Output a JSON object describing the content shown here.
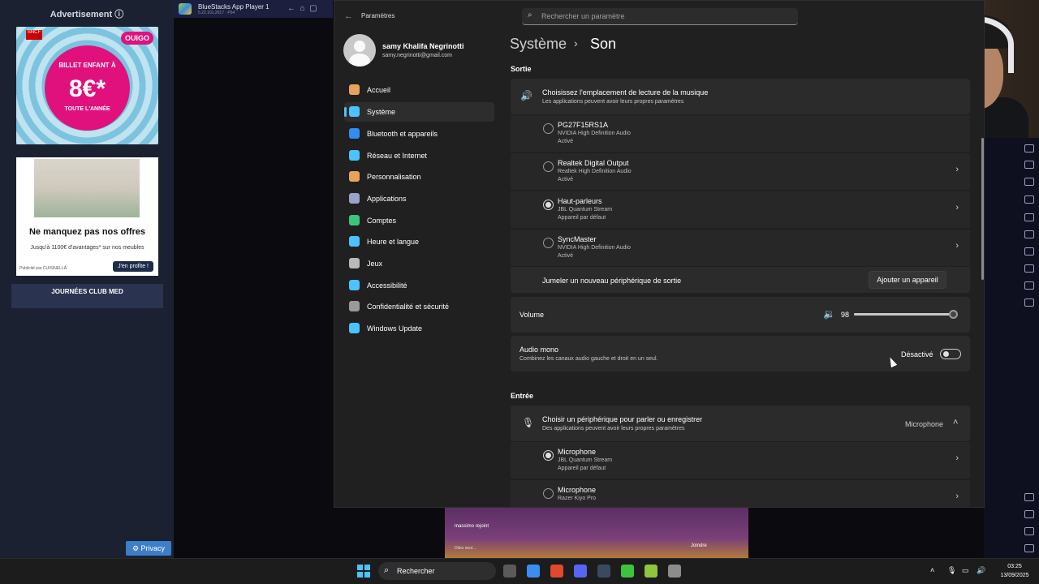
{
  "ads": {
    "title": "Advertisement",
    "info_icon": "info-icon",
    "ad1": {
      "brand": "OUIGO",
      "sncf": "SNCF",
      "line1": "BILLET ENFANT À",
      "line2": "8€*",
      "line3": "TOUTE L'ANNÉE"
    },
    "ad2": {
      "headline": "Ne manquez pas nos offres",
      "body": "Jusqu'à 1100€ d'avantages* sur nos meubles",
      "advertiser": "Publicité par CUISINELLA",
      "cta": "J'en profite !"
    },
    "ad3": {
      "text": "JOURNÉES CLUB MED"
    },
    "privacy": "Privacy"
  },
  "bluestacks": {
    "title": "BlueStacks App Player 1",
    "version": "5.22.101.2017 · P64",
    "bottom": {
      "chat": "massimo rejoint",
      "input": "Dites seul...",
      "join": "Joindre"
    }
  },
  "settings": {
    "app_title": "Paramètres",
    "search_placeholder": "Rechercher un paramètre",
    "user": {
      "name": "samy Khalifa Negrinotti",
      "email": "samy.negrinotti@gmail.com"
    },
    "nav": [
      {
        "label": "Accueil",
        "icon": "home-icon",
        "color": "#e8a35a"
      },
      {
        "label": "Système",
        "icon": "system-icon",
        "color": "#4cc2ff"
      },
      {
        "label": "Bluetooth et appareils",
        "icon": "bluetooth-icon",
        "color": "#2f8ef0"
      },
      {
        "label": "Réseau et Internet",
        "icon": "wifi-icon",
        "color": "#4cc2ff"
      },
      {
        "label": "Personnalisation",
        "icon": "brush-icon",
        "color": "#e8a35a"
      },
      {
        "label": "Applications",
        "icon": "apps-icon",
        "color": "#9aa4c7"
      },
      {
        "label": "Comptes",
        "icon": "account-icon",
        "color": "#3cc47c"
      },
      {
        "label": "Heure et langue",
        "icon": "globe-icon",
        "color": "#4cc2ff"
      },
      {
        "label": "Jeux",
        "icon": "gamepad-icon",
        "color": "#b9b9b9"
      },
      {
        "label": "Accessibilité",
        "icon": "accessibility-icon",
        "color": "#4cc2ff"
      },
      {
        "label": "Confidentialité et sécurité",
        "icon": "shield-icon",
        "color": "#9a9a9a"
      },
      {
        "label": "Windows Update",
        "icon": "update-icon",
        "color": "#4cc2ff"
      }
    ],
    "breadcrumb": {
      "parent": "Système",
      "separator": "›",
      "current": "Son"
    },
    "output": {
      "section": "Sortie",
      "title": "Choisissez l'emplacement de lecture de la musique",
      "subtitle": "Les applications peuvent avoir leurs propres paramètres",
      "devices": [
        {
          "name": "PG27F15RS1A",
          "driver": "NVIDIA High Definition Audio",
          "status": "Activé",
          "selected": false
        },
        {
          "name": "Realtek Digital Output",
          "driver": "Realtek High Definition Audio",
          "status": "Activé",
          "selected": false
        },
        {
          "name": "Haut-parleurs",
          "driver": "JBL Quantum Stream",
          "status": "Appareil par défaut",
          "selected": true
        },
        {
          "name": "SyncMaster",
          "driver": "NVIDIA High Definition Audio",
          "status": "Activé",
          "selected": false
        }
      ],
      "pair_label": "Jumeler un nouveau périphérique de sortie",
      "add_button": "Ajouter un appareil",
      "volume_label": "Volume",
      "volume_value": "98",
      "volume_percent": 98,
      "mono_title": "Audio mono",
      "mono_sub": "Combinez les canaux audio gauche et droit en un seul.",
      "mono_state": "Désactivé"
    },
    "input": {
      "section": "Entrée",
      "title": "Choisir un périphérique pour parler ou enregistrer",
      "subtitle": "Des applications peuvent avoir leurs propres paramètres",
      "selected": "Microphone",
      "devices": [
        {
          "name": "Microphone",
          "driver": "JBL Quantum Stream",
          "status": "Appareil par défaut",
          "selected": true
        },
        {
          "name": "Microphone",
          "driver": "Razer Kiyo Pro",
          "status": "",
          "selected": false
        }
      ]
    }
  },
  "taskbar": {
    "search_label": "Rechercher",
    "time": "03:25",
    "date": "13/09/2025",
    "apps": [
      {
        "name": "file-explorer-icon",
        "color": "#5a5a5a"
      },
      {
        "name": "chrome-icon",
        "color": "#3b8ef0"
      },
      {
        "name": "brave-icon",
        "color": "#e0492b"
      },
      {
        "name": "discord-icon",
        "color": "#5865f2"
      },
      {
        "name": "steam-icon",
        "color": "#3a4a5e"
      },
      {
        "name": "app-green-icon",
        "color": "#3cc43c"
      },
      {
        "name": "bluestacks-icon",
        "color": "#8ec63f"
      },
      {
        "name": "settings-icon",
        "color": "#8c8c8c"
      }
    ]
  }
}
